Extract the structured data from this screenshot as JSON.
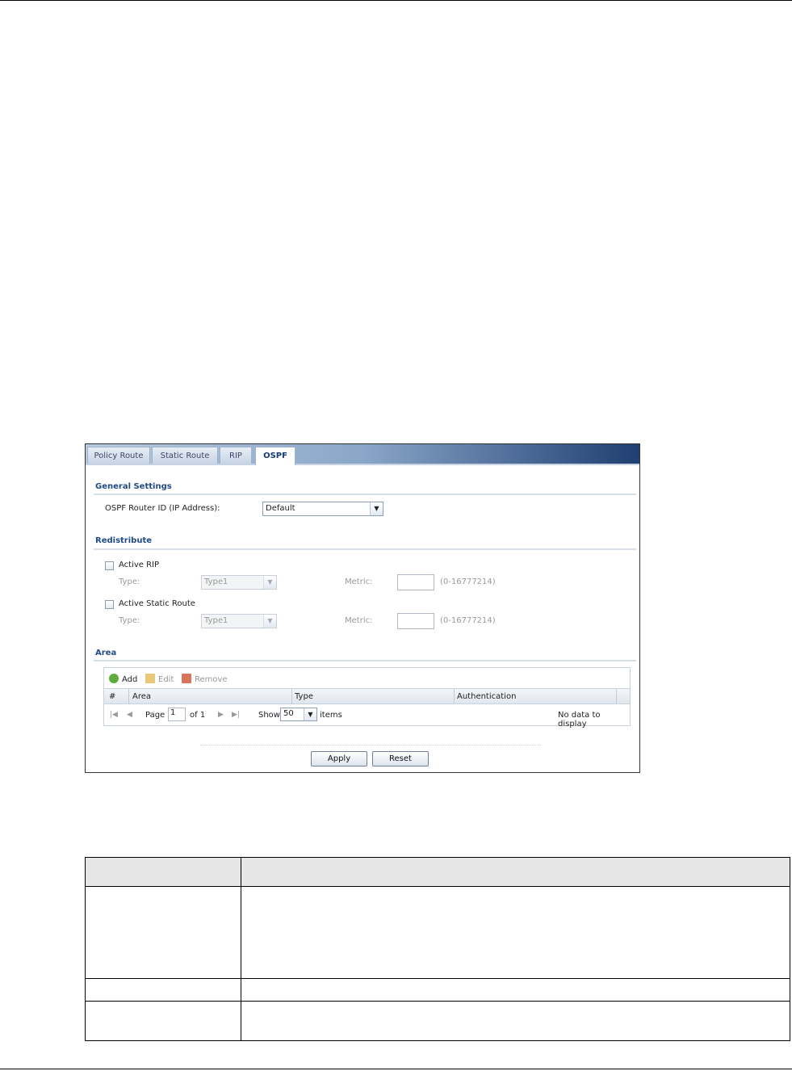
{
  "tabs": [
    {
      "label": "Policy Route",
      "active": false
    },
    {
      "label": "Static Route",
      "active": false
    },
    {
      "label": "RIP",
      "active": false
    },
    {
      "label": "OSPF",
      "active": true
    }
  ],
  "general_settings": {
    "title": "General Settings",
    "router_id_label": "OSPF Router ID (IP Address):",
    "router_id_value": "Default"
  },
  "redistribute": {
    "title": "Redistribute",
    "active_rip_label": "Active RIP",
    "active_static_label": "Active Static Route",
    "type_label": "Type:",
    "type_value": "Type1",
    "metric_label": "Metric:",
    "metric_range": "(0-16777214)"
  },
  "area": {
    "title": "Area",
    "toolbar": {
      "add": "Add",
      "edit": "Edit",
      "remove": "Remove"
    },
    "columns": [
      "#",
      "Area",
      "Type",
      "Authentication"
    ],
    "pager": {
      "page_label": "Page",
      "page_value": "1",
      "of_label": "of 1",
      "show_label": "Show",
      "show_value": "50",
      "items_label": "items",
      "empty_text": "No data to display"
    }
  },
  "buttons": {
    "apply": "Apply",
    "reset": "Reset"
  },
  "colors": {
    "accent": "#1f4a86",
    "tab_gradient_end": "#1f3f72"
  }
}
